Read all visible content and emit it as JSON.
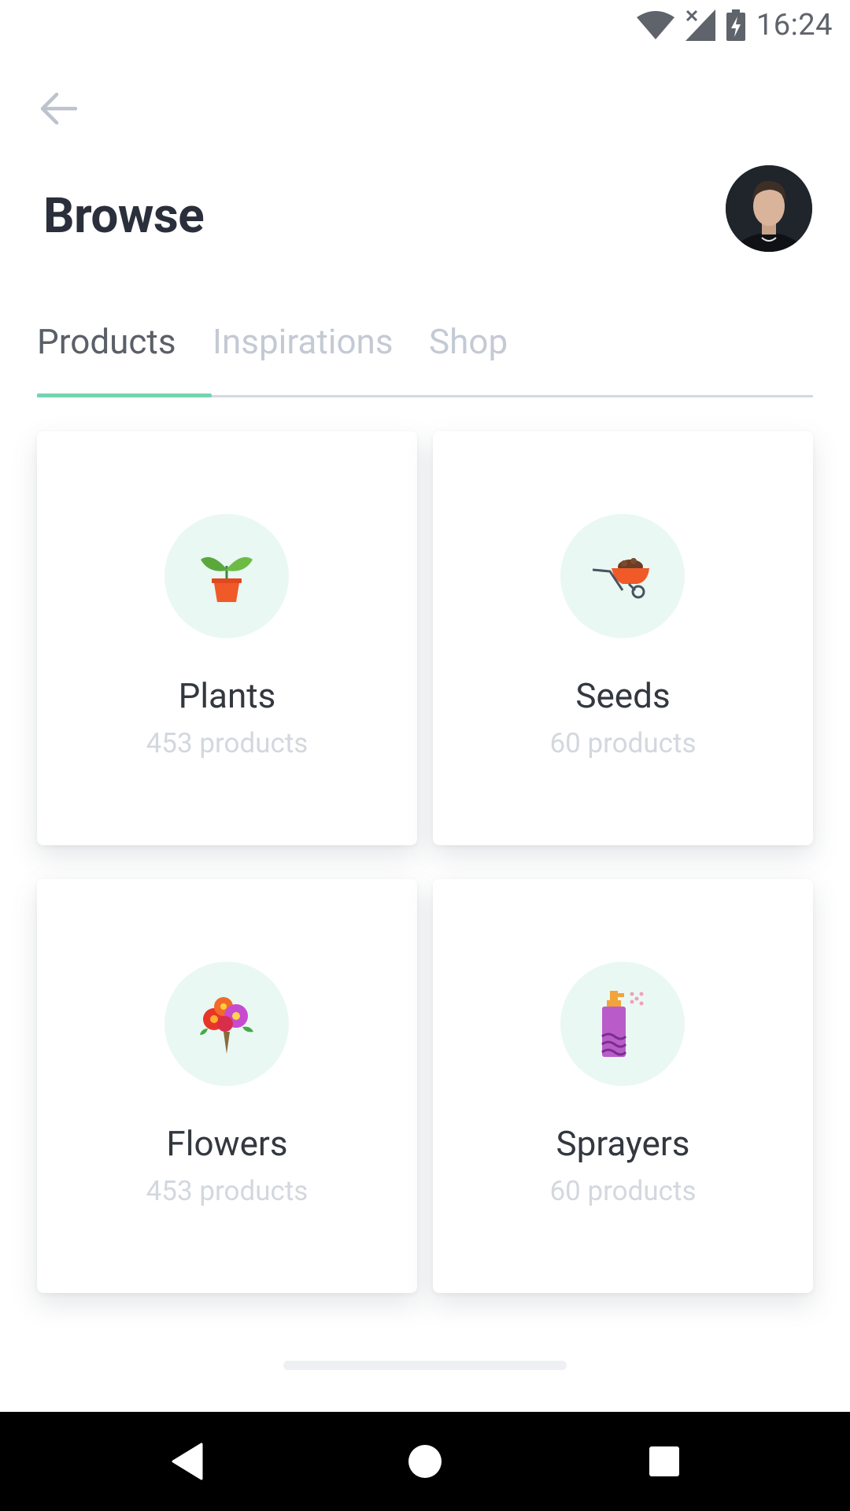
{
  "status_bar": {
    "time": "16:24",
    "icons": [
      "wifi-icon",
      "cellular-no-signal-icon",
      "battery-charging-icon"
    ]
  },
  "header": {
    "back_icon": "arrow-left-icon",
    "title": "Browse",
    "avatar": "user-avatar"
  },
  "tabs": [
    {
      "label": "Products",
      "active": true
    },
    {
      "label": "Inspirations",
      "active": false
    },
    {
      "label": "Shop",
      "active": false
    }
  ],
  "categories": [
    {
      "title": "Plants",
      "count": "453 products",
      "icon": "potted-plant-icon"
    },
    {
      "title": "Seeds",
      "count": "60 products",
      "icon": "wheelbarrow-icon"
    },
    {
      "title": "Flowers",
      "count": "453 products",
      "icon": "flower-bouquet-icon"
    },
    {
      "title": "Sprayers",
      "count": "60 products",
      "icon": "spray-bottle-icon"
    }
  ],
  "colors": {
    "accent": "#74d3b0",
    "icon_circle_bg": "#e9f8f3",
    "title_text": "#2a2f3b",
    "muted_text": "#d3d7de",
    "inactive_tab": "#c4cad4"
  },
  "nav_bar": {
    "buttons": [
      "back-triangle-icon",
      "home-circle-icon",
      "recents-square-icon"
    ]
  }
}
